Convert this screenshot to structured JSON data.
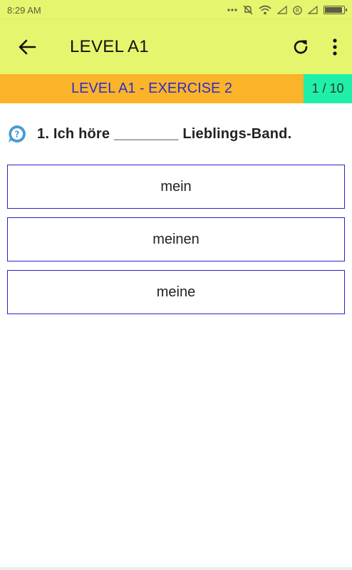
{
  "status_bar": {
    "time": "8:29 AM",
    "icons": [
      "dots-icon",
      "mute-icon",
      "wifi-icon",
      "signal-icon",
      "registered-icon",
      "signal-icon",
      "battery-icon"
    ],
    "battery_level": 0.9
  },
  "app_bar": {
    "title": "LEVEL A1",
    "back_icon": "arrow-left-icon",
    "refresh_icon": "refresh-icon",
    "menu_icon": "more-vert-icon",
    "background": "#e6f56e"
  },
  "exercise": {
    "title": "LEVEL A1 - EXERCISE 2",
    "progress": "1 / 10",
    "title_background": "#fbb32a",
    "progress_background": "#1ff0a8",
    "title_color": "#2b2fc7"
  },
  "question": {
    "icon": "help-bubble-icon",
    "text": "1. Ich höre ________ Lieblings-Band."
  },
  "options": [
    {
      "label": "mein"
    },
    {
      "label": "meinen"
    },
    {
      "label": "meine"
    }
  ]
}
